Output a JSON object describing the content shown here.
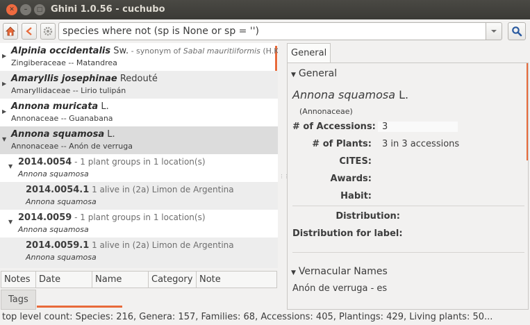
{
  "window": {
    "title": "Ghini 1.0.56 - cuchubo"
  },
  "toolbar": {
    "search_value": "species where not (sp is None or sp = '')"
  },
  "results": [
    {
      "name": "Alpinia occidentalis",
      "author": "Sw.",
      "note_prefix": " - synonym of ",
      "note_italic": "Sabal mauritiiformis",
      "note_suffix": " (H.K...",
      "sub": "Zingiberaceae -- Matandrea"
    },
    {
      "name": "Amaryllis josephinae",
      "author": "Redouté",
      "sub": "Amaryllidaceae -- Lirio tulipán"
    },
    {
      "name": "Annona muricata",
      "author": "L.",
      "sub": "Annonaceae -- Guanabana"
    },
    {
      "name": "Annona squamosa",
      "author": "L.",
      "sub": "Annonaceae -- Anón de verruga"
    }
  ],
  "accessions": [
    {
      "code": "2014.0054",
      "desc": " - 1 plant groups in 1 location(s)",
      "species": "Annona squamosa"
    },
    {
      "code": "2014.0059",
      "desc": " - 1 plant groups in 1 location(s)",
      "species": "Annona squamosa"
    }
  ],
  "plants": [
    {
      "code": "2014.0054.1",
      "desc": " 1 alive in (2a) Limon de Argentina",
      "species": "Annona squamosa"
    },
    {
      "code": "2014.0059.1",
      "desc": " 1 alive in (2a) Limon de Argentina",
      "species": "Annona squamosa"
    }
  ],
  "notes": {
    "columns": [
      "Notes",
      "Date",
      "Name",
      "Category",
      "Note"
    ],
    "tags_tab": "Tags"
  },
  "infobox": {
    "tab": "General",
    "general_header": "General",
    "species_name": "Annona squamosa",
    "species_author": "L.",
    "family": "(Annonaceae)",
    "fields": [
      {
        "label": "# of Accessions:",
        "value": "3"
      },
      {
        "label": "# of Plants:",
        "value": "3 in 3 accessions"
      },
      {
        "label": "CITES:",
        "value": ""
      },
      {
        "label": "Awards:",
        "value": ""
      },
      {
        "label": "Habit:",
        "value": ""
      },
      {
        "label": "Distribution:",
        "value": ""
      },
      {
        "label": "Distribution for label:",
        "value": ""
      }
    ],
    "vernacular_header": "Vernacular Names",
    "vernacular_value": "Anón de verruga - es"
  },
  "statusbar": {
    "text": "top level count: Species: 216, Genera: 157, Families: 68, Accessions: 405, Plantings: 429, Living plants: 50..."
  },
  "colors": {
    "accent": "#e86a3a",
    "titlebar": "#3b3a36",
    "close": "#ef6a3f"
  }
}
